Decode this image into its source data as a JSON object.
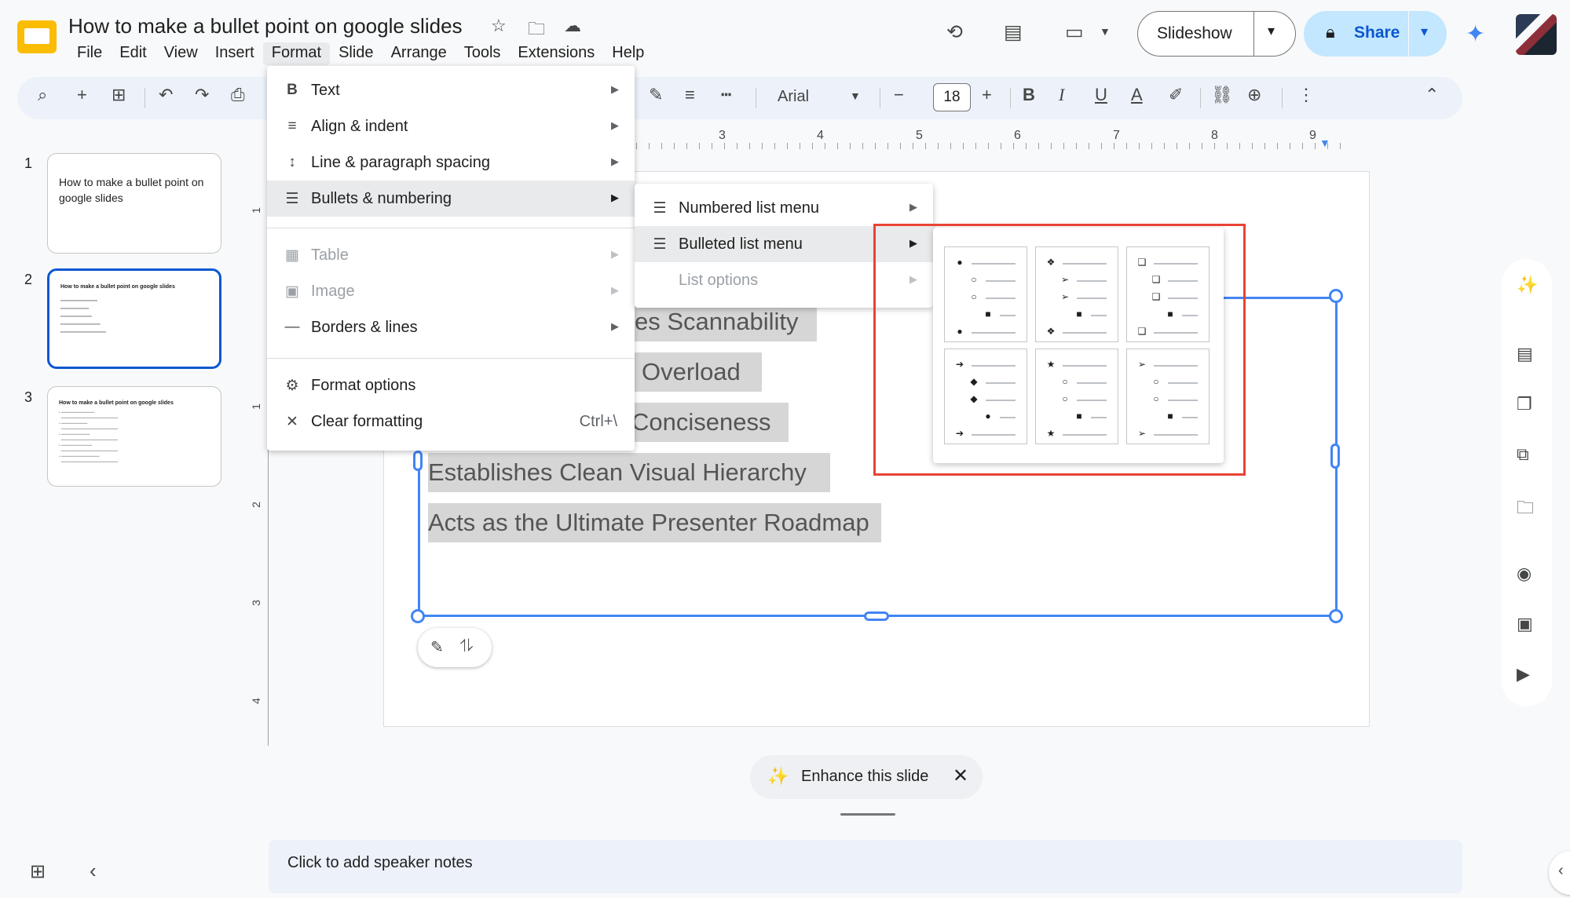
{
  "app": {
    "title": "How to make a bullet point on google slides",
    "menus": [
      "File",
      "Edit",
      "View",
      "Insert",
      "Format",
      "Slide",
      "Arrange",
      "Tools",
      "Extensions",
      "Help"
    ],
    "active_menu": "Format",
    "slideshow_label": "Slideshow",
    "share_label": "Share"
  },
  "toolbar": {
    "font_name": "Arial",
    "font_size": "18"
  },
  "filmstrip": {
    "slides": [
      {
        "num": "1",
        "title": "How to make a bullet point on google slides"
      },
      {
        "num": "2",
        "title": "How to make a bullet point on google slides"
      },
      {
        "num": "3",
        "title": "How to make a bullet point on google slides"
      }
    ]
  },
  "ruler": {
    "h": [
      "3",
      "4",
      "5",
      "6",
      "7",
      "8",
      "9"
    ],
    "v": [
      "1",
      "1",
      "2",
      "3",
      "4"
    ]
  },
  "slide": {
    "lines": [
      "es Scannability",
      "Overload",
      "Conciseness",
      "Establishes Clean Visual Hierarchy",
      "Acts as the Ultimate Presenter Roadmap"
    ]
  },
  "format_menu": {
    "items": [
      {
        "icon": "B",
        "label": "Text"
      },
      {
        "icon": "≡",
        "label": "Align & indent"
      },
      {
        "icon": "↕",
        "label": "Line & paragraph spacing"
      },
      {
        "icon": "☰",
        "label": "Bullets & numbering"
      },
      {
        "icon": "▦",
        "label": "Table"
      },
      {
        "icon": "▣",
        "label": "Image"
      },
      {
        "icon": "—",
        "label": "Borders & lines"
      },
      {
        "icon": "⚙",
        "label": "Format options"
      },
      {
        "icon": "✕",
        "label": "Clear formatting",
        "shortcut": "Ctrl+\\"
      }
    ]
  },
  "bullets_submenu": {
    "items": [
      {
        "label": "Numbered list menu"
      },
      {
        "label": "Bulleted list menu"
      },
      {
        "label": "List options"
      }
    ]
  },
  "bullet_presets": [
    [
      "●",
      "○",
      "○",
      "■",
      "●"
    ],
    [
      "❖",
      "➢",
      "➢",
      "■",
      "❖"
    ],
    [
      "❑",
      "❑",
      "❑",
      "■",
      "❑"
    ],
    [
      "➔",
      "◆",
      "◆",
      "●",
      "➔"
    ],
    [
      "★",
      "○",
      "○",
      "■",
      "★"
    ],
    [
      "➢",
      "○",
      "○",
      "■",
      "➢"
    ]
  ],
  "bottom": {
    "enhance_label": "Enhance this slide",
    "notes_placeholder": "Click to add speaker notes"
  },
  "colors": {
    "accent": "#0b57d0",
    "selection": "#4285f4",
    "highlight_box": "#ea4335"
  }
}
